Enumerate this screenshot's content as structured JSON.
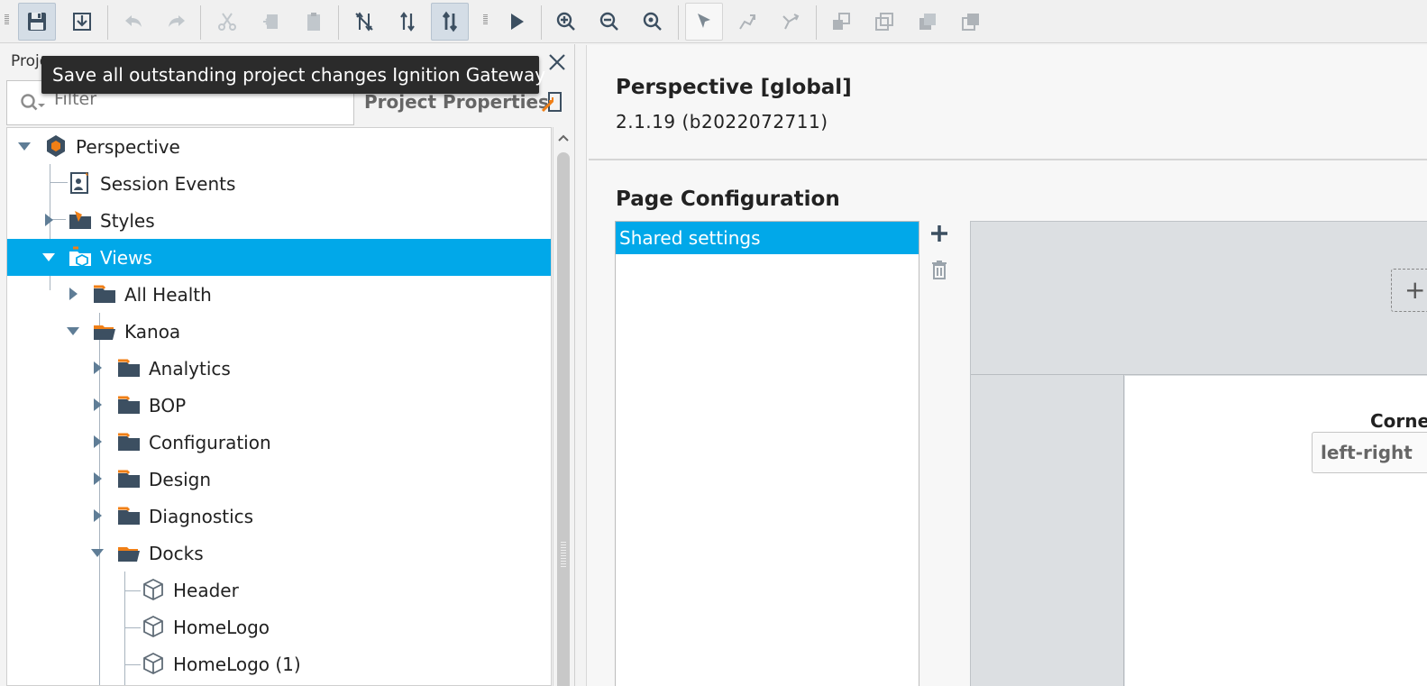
{
  "tooltip": {
    "text": "Save all outstanding project changes Ignition Gateway"
  },
  "left_panel": {
    "title": "Proje",
    "filter_placeholder": "Filter",
    "project_properties": "Project Properties"
  },
  "tree": [
    {
      "label": "Perspective",
      "icon": "perspective-module-icon",
      "expanded": true
    },
    {
      "label": "Session Events",
      "icon": "session-events-icon"
    },
    {
      "label": "Styles",
      "icon": "styles-folder-icon",
      "expanded": false
    },
    {
      "label": "Views",
      "icon": "views-folder-icon",
      "expanded": true,
      "selected": true
    },
    {
      "label": "All Health",
      "icon": "folder-icon",
      "expanded": false
    },
    {
      "label": "Kanoa",
      "icon": "folder-open-icon",
      "expanded": true
    },
    {
      "label": "Analytics",
      "icon": "folder-icon",
      "expanded": false
    },
    {
      "label": "BOP",
      "icon": "folder-icon",
      "expanded": false
    },
    {
      "label": "Configuration",
      "icon": "folder-icon",
      "expanded": false
    },
    {
      "label": "Design",
      "icon": "folder-icon",
      "expanded": false
    },
    {
      "label": "Diagnostics",
      "icon": "folder-icon",
      "expanded": false
    },
    {
      "label": "Docks",
      "icon": "folder-open-icon",
      "expanded": true
    },
    {
      "label": "Header",
      "icon": "view-cube-icon"
    },
    {
      "label": "HomeLogo",
      "icon": "view-cube-icon"
    },
    {
      "label": "HomeLogo (1)",
      "icon": "view-cube-icon"
    }
  ],
  "right_panel": {
    "module_title": "Perspective [global]",
    "module_version": "2.1.19 (b2022072711)",
    "section_title": "Page Configuration",
    "config_items": [
      "Shared settings"
    ],
    "corner_label": "Corne",
    "corner_select_value": "left-right"
  },
  "colors": {
    "selection": "#01a8e9",
    "tooltip_bg": "#2b2b2b"
  }
}
